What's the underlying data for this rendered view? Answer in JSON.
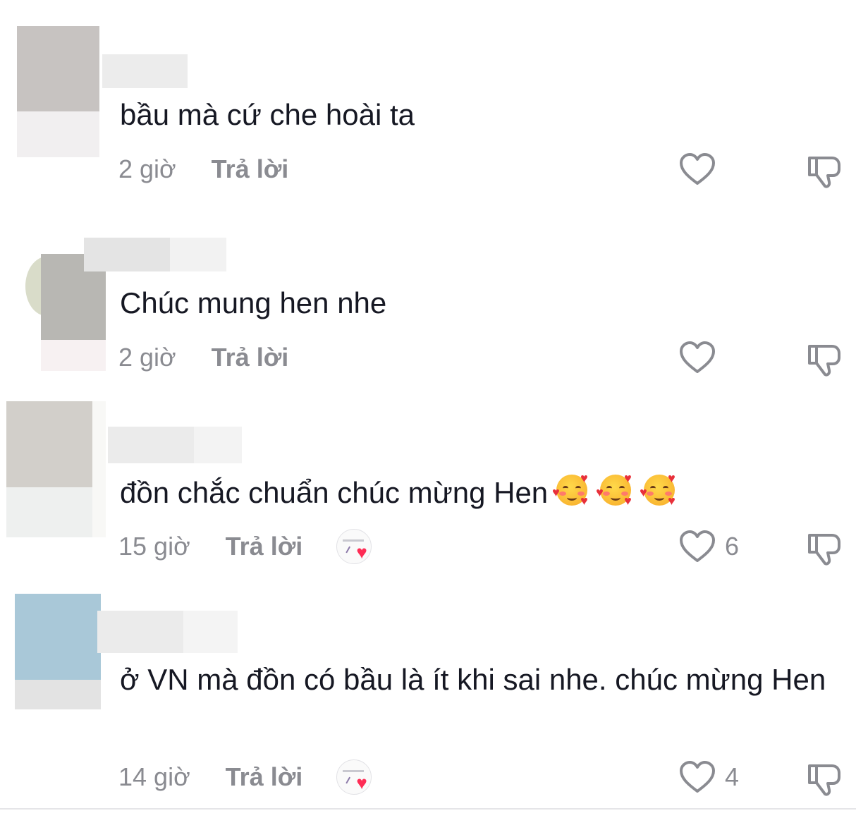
{
  "comments": [
    {
      "text": "bầu mà cứ che hoài ta",
      "time": "2 giờ",
      "reply": "Trả lời",
      "likes": "",
      "creator_liked": false
    },
    {
      "text": "Chúc mung hen nhe",
      "time": "2 giờ",
      "reply": "Trả lời",
      "likes": "",
      "creator_liked": false
    },
    {
      "text": "đồn chắc chuẩn chúc mừng Hen",
      "emoji": "smiling-face-with-hearts x3",
      "time": "15 giờ",
      "reply": "Trả lời",
      "likes": "6",
      "creator_liked": true
    },
    {
      "text": "ở VN mà đồn có bầu là ít khi sai nhe. chúc mừng Hen",
      "time": "14 giờ",
      "reply": "Trả lời",
      "likes": "4",
      "creator_liked": true
    }
  ],
  "colors": {
    "text": "#161823",
    "muted": "#8a8b91",
    "heart_accent": "#fe2c55"
  },
  "icons": [
    "heart-outline-icon",
    "dislike-icon",
    "creator-liked-icon",
    "smiling-face-with-hearts-emoji"
  ]
}
